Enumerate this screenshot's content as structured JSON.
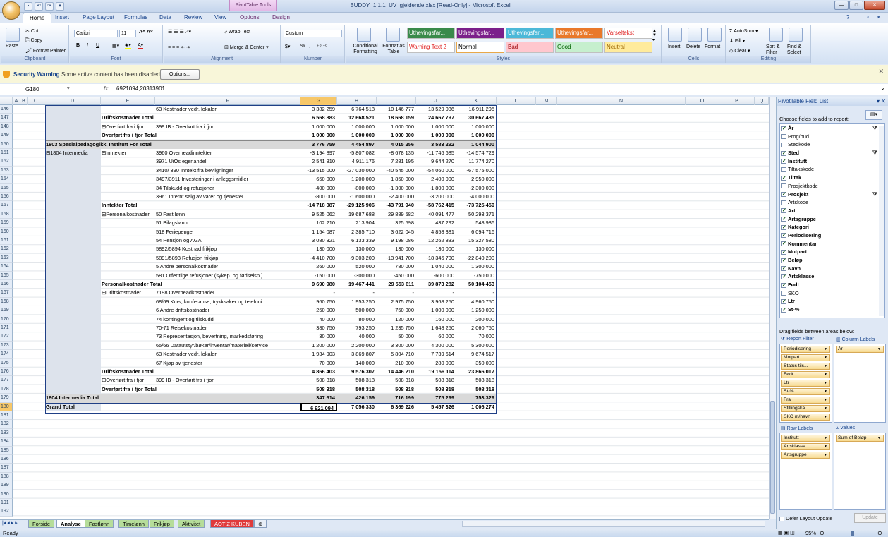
{
  "window": {
    "title": "BUDDY_1.1.1_UV_gjeldende.xlsx [Read-Only] - Microsoft Excel",
    "context_tab": "PivotTable Tools"
  },
  "tabs": [
    "Home",
    "Insert",
    "Page Layout",
    "Formulas",
    "Data",
    "Review",
    "View",
    "Options",
    "Design"
  ],
  "ribbon": {
    "clipboard": {
      "label": "Clipboard",
      "paste": "Paste",
      "cut": "Cut",
      "copy": "Copy",
      "format_painter": "Format Painter"
    },
    "font": {
      "label": "Font",
      "name": "Calibri",
      "size": "11",
      "bold": "B",
      "italic": "I",
      "underline": "U"
    },
    "alignment": {
      "label": "Alignment",
      "wrap": "Wrap Text",
      "merge": "Merge & Center"
    },
    "number": {
      "label": "Number",
      "format": "Custom",
      "pct": "%",
      "comma": ","
    },
    "styles": {
      "label": "Styles",
      "cond": "Conditional Formatting",
      "table": "Format as Table",
      "cells": [
        {
          "text": "Uthevingsfar...",
          "bg": "#3a8a4a",
          "fg": "#ffffff"
        },
        {
          "text": "Uthevingsfar...",
          "bg": "#7b1f8a",
          "fg": "#ffffff"
        },
        {
          "text": "Uthevingsfar...",
          "bg": "#4bb8d8",
          "fg": "#ffffff"
        },
        {
          "text": "Uthevingsfar...",
          "bg": "#e9782a",
          "fg": "#ffffff"
        },
        {
          "text": "Varseltekst",
          "bg": "#ffffff",
          "fg": "#e02020"
        },
        {
          "text": "Warning Text 2",
          "bg": "#ffffff",
          "fg": "#e02020"
        },
        {
          "text": "Normal",
          "bg": "#ffffff",
          "fg": "#000000"
        },
        {
          "text": "Bad",
          "bg": "#ffc7ce",
          "fg": "#9c0006"
        },
        {
          "text": "Good",
          "bg": "#c6efce",
          "fg": "#006100"
        },
        {
          "text": "Neutral",
          "bg": "#ffeb9c",
          "fg": "#9c6500"
        }
      ]
    },
    "cells": {
      "label": "Cells",
      "insert": "Insert",
      "delete": "Delete",
      "format": "Format"
    },
    "editing": {
      "label": "Editing",
      "autosum": "AutoSum",
      "fill": "Fill",
      "clear": "Clear",
      "sort": "Sort & Filter",
      "find": "Find & Select"
    }
  },
  "security": {
    "title": "Security Warning",
    "message": "Some active content has been disabled.",
    "button": "Options..."
  },
  "formula_bar": {
    "name_box": "G180",
    "fx": "fx",
    "value": "6921094,20313901"
  },
  "columns": [
    "A",
    "B",
    "C",
    "D",
    "E",
    "F",
    "G",
    "H",
    "I",
    "J",
    "K",
    "L",
    "M",
    "N",
    "O",
    "P",
    "Q"
  ],
  "rows": [
    {
      "n": "146",
      "d": "",
      "e": "",
      "f": "63 Kostnader vedr. lokaler",
      "v": [
        "3 382 259",
        "6 764 518",
        "10 146 777",
        "13 529 036",
        "16 911 295"
      ]
    },
    {
      "n": "147",
      "d": "",
      "e": "Driftskostnader Total",
      "f": "",
      "v": [
        "6 568 883",
        "12 668 521",
        "18 668 159",
        "24 667 797",
        "30 667 435"
      ],
      "bold": true
    },
    {
      "n": "148",
      "d": "",
      "e": "⊟Overført fra i fjor",
      "f": "399 IB - Overført fra i fjor",
      "v": [
        "1 000 000",
        "1 000 000",
        "1 000 000",
        "1 000 000",
        "1 000 000"
      ]
    },
    {
      "n": "149",
      "d": "",
      "e": "Overført fra i fjor Total",
      "f": "",
      "v": [
        "1 000 000",
        "1 000 000",
        "1 000 000",
        "1 000 000",
        "1 000 000"
      ],
      "bold": true
    },
    {
      "n": "150",
      "d": "1803 Spesialpedagogikk, Institutt For Total",
      "e": "",
      "f": "",
      "v": [
        "3 776 759",
        "4 454 897",
        "4 015 256",
        "3 583 292",
        "1 044 900"
      ],
      "bold": true,
      "shade": true
    },
    {
      "n": "151",
      "d": "⊟1804 Intermedia",
      "e": "⊟Inntekter",
      "f": "3960 Overheadinntekter",
      "v": [
        "-3 194 897",
        "-5 807 082",
        "-8 678 135",
        "-11 746 685",
        "-14 574 729"
      ]
    },
    {
      "n": "152",
      "d": "",
      "e": "",
      "f": "3971 UiOs egenandel",
      "v": [
        "2 541 810",
        "4 911 176",
        "7 281 195",
        "9 644 270",
        "11 774 270"
      ]
    },
    {
      "n": "153",
      "d": "",
      "e": "",
      "f": "3410/ 390 Inntekt fra bevilgninger",
      "v": [
        "-13 515 000",
        "-27 030 000",
        "-40 545 000",
        "-54 060 000",
        "-67 575 000"
      ]
    },
    {
      "n": "154",
      "d": "",
      "e": "",
      "f": "3497/3911 Investeringer i anleggsmidler",
      "v": [
        "650 000",
        "1 200 000",
        "1 850 000",
        "2 400 000",
        "2 950 000"
      ]
    },
    {
      "n": "155",
      "d": "",
      "e": "",
      "f": "34 Tilskudd og refusjoner",
      "v": [
        "-400 000",
        "-800 000",
        "-1 300 000",
        "-1 800 000",
        "-2 300 000"
      ]
    },
    {
      "n": "156",
      "d": "",
      "e": "",
      "f": "3961 Internt salg av varer og tjenester",
      "v": [
        "-800 000",
        "-1 600 000",
        "-2 400 000",
        "-3 200 000",
        "-4 000 000"
      ]
    },
    {
      "n": "157",
      "d": "",
      "e": "Inntekter Total",
      "f": "",
      "v": [
        "-14 718 087",
        "-29 125 906",
        "-43 791 940",
        "-58 762 415",
        "-73 725 459"
      ],
      "bold": true
    },
    {
      "n": "158",
      "d": "",
      "e": "⊟Personalkostnader",
      "f": "50 Fast lønn",
      "v": [
        "9 525 062",
        "19 687 688",
        "29 889 582",
        "40 091 477",
        "50 293 371"
      ]
    },
    {
      "n": "159",
      "d": "",
      "e": "",
      "f": "51 Bilagslønn",
      "v": [
        "102 210",
        "213 904",
        "325 598",
        "437 292",
        "548 986"
      ]
    },
    {
      "n": "160",
      "d": "",
      "e": "",
      "f": "518 Feriepenger",
      "v": [
        "1 154 087",
        "2 385 710",
        "3 622 045",
        "4 858 381",
        "6 094 716"
      ]
    },
    {
      "n": "161",
      "d": "",
      "e": "",
      "f": "54 Pensjon og AGA",
      "v": [
        "3 080 321",
        "6 133 339",
        "9 198 086",
        "12 262 833",
        "15 327 580"
      ]
    },
    {
      "n": "162",
      "d": "",
      "e": "",
      "f": "5892/5894 Kostnad frikjøp",
      "v": [
        "130 000",
        "130 000",
        "130 000",
        "130 000",
        "130 000"
      ]
    },
    {
      "n": "163",
      "d": "",
      "e": "",
      "f": "5891/5893 Refusjon frikjøp",
      "v": [
        "-4 410 700",
        "-9 303 200",
        "-13 941 700",
        "-18 346 700",
        "-22 840 200"
      ]
    },
    {
      "n": "164",
      "d": "",
      "e": "",
      "f": "5 Andre personalkostnader",
      "v": [
        "260 000",
        "520 000",
        "780 000",
        "1 040 000",
        "1 300 000"
      ]
    },
    {
      "n": "165",
      "d": "",
      "e": "",
      "f": "581 Offentlige refusjoner (sykep. og fødselsp.)",
      "v": [
        "-150 000",
        "-300 000",
        "-450 000",
        "-600 000",
        "-750 000"
      ]
    },
    {
      "n": "166",
      "d": "",
      "e": "Personalkostnader Total",
      "f": "",
      "v": [
        "9 690 980",
        "19 467 441",
        "29 553 611",
        "39 873 282",
        "50 104 453"
      ],
      "bold": true
    },
    {
      "n": "167",
      "d": "",
      "e": "⊟Driftskostnader",
      "f": "7198 Overheadkostnader",
      "v": [
        "-",
        "-",
        "-",
        "-",
        "-"
      ]
    },
    {
      "n": "168",
      "d": "",
      "e": "",
      "f": "68/69 Kurs, konferanse, trykksaker og telefoni",
      "v": [
        "960 750",
        "1 953 250",
        "2 975 750",
        "3 968 250",
        "4 960 750"
      ]
    },
    {
      "n": "169",
      "d": "",
      "e": "",
      "f": "6 Andre driftskostnader",
      "v": [
        "250 000",
        "500 000",
        "750 000",
        "1 000 000",
        "1 250 000"
      ]
    },
    {
      "n": "170",
      "d": "",
      "e": "",
      "f": "74 kontingent og tilskudd",
      "v": [
        "40 000",
        "80 000",
        "120 000",
        "160 000",
        "200 000"
      ]
    },
    {
      "n": "171",
      "d": "",
      "e": "",
      "f": "70-71 Reisekostnader",
      "v": [
        "380 750",
        "793 250",
        "1 235 750",
        "1 648 250",
        "2 060 750"
      ]
    },
    {
      "n": "172",
      "d": "",
      "e": "",
      "f": "73 Representasjon, bevertning, markedsføring",
      "v": [
        "30 000",
        "40 000",
        "50 000",
        "60 000",
        "70 000"
      ]
    },
    {
      "n": "173",
      "d": "",
      "e": "",
      "f": "65/66 Datautstyr/bøker/inventar/materiell/service",
      "v": [
        "1 200 000",
        "2 200 000",
        "3 300 000",
        "4 300 000",
        "5 300 000"
      ]
    },
    {
      "n": "174",
      "d": "",
      "e": "",
      "f": "63 Kostnader vedr. lokaler",
      "v": [
        "1 934 903",
        "3 869 807",
        "5 804 710",
        "7 739 614",
        "9 674 517"
      ]
    },
    {
      "n": "175",
      "d": "",
      "e": "",
      "f": "67 Kjøp av tjenester",
      "v": [
        "70 000",
        "140 000",
        "210 000",
        "280 000",
        "350 000"
      ]
    },
    {
      "n": "176",
      "d": "",
      "e": "Driftskostnader Total",
      "f": "",
      "v": [
        "4 866 403",
        "9 576 307",
        "14 446 210",
        "19 156 114",
        "23 866 017"
      ],
      "bold": true
    },
    {
      "n": "177",
      "d": "",
      "e": "⊟Overført fra i fjor",
      "f": "399 IB - Overført fra i fjor",
      "v": [
        "508 318",
        "508 318",
        "508 318",
        "508 318",
        "508 318"
      ]
    },
    {
      "n": "178",
      "d": "",
      "e": "Overført fra i fjor Total",
      "f": "",
      "v": [
        "508 318",
        "508 318",
        "508 318",
        "508 318",
        "508 318"
      ],
      "bold": true
    },
    {
      "n": "179",
      "d": "1804 Intermedia Total",
      "e": "",
      "f": "",
      "v": [
        "347 614",
        "426 159",
        "716 199",
        "775 299",
        "753 329"
      ],
      "bold": true,
      "shade": true
    },
    {
      "n": "180",
      "d": "Grand Total",
      "e": "",
      "f": "",
      "v": [
        "6 921 094",
        "7 056 330",
        "6 369 226",
        "5 457 326",
        "1 006 274"
      ],
      "bold": true,
      "grand": true
    }
  ],
  "empty_rows": [
    "181",
    "182",
    "183",
    "184",
    "185",
    "186",
    "187",
    "188",
    "189",
    "190",
    "191",
    "192"
  ],
  "sheet_tabs": [
    "Forside",
    "Analyse",
    "Fastlønn",
    "Timelønn",
    "Frikjøp",
    "Aktivitet",
    "AOT Z KUBEN"
  ],
  "status": {
    "left": "Ready",
    "zoom": "95%"
  },
  "pivot_pane": {
    "title": "PivotTable Field List",
    "choose": "Choose fields to add to report:",
    "fields": [
      {
        "name": "År",
        "checked": true,
        "filter": true
      },
      {
        "name": "Prog/bud",
        "checked": false
      },
      {
        "name": "Stedkode",
        "checked": false
      },
      {
        "name": "Sted",
        "checked": true,
        "filter": true
      },
      {
        "name": "Institutt",
        "checked": true
      },
      {
        "name": "Tiltakskode",
        "checked": false
      },
      {
        "name": "Tiltak",
        "checked": true
      },
      {
        "name": "Prosjektkode",
        "checked": false
      },
      {
        "name": "Prosjekt",
        "checked": true,
        "filter": true
      },
      {
        "name": "Artskode",
        "checked": false
      },
      {
        "name": "Art",
        "checked": true
      },
      {
        "name": "Artsgruppe",
        "checked": true
      },
      {
        "name": "Kategori",
        "checked": true
      },
      {
        "name": "Periodisering",
        "checked": true
      },
      {
        "name": "Kommentar",
        "checked": true
      },
      {
        "name": "Motpart",
        "checked": true
      },
      {
        "name": "Beløp",
        "checked": true
      },
      {
        "name": "Navn",
        "checked": true
      },
      {
        "name": "Artsklasse",
        "checked": true
      },
      {
        "name": "Født",
        "checked": true
      },
      {
        "name": "SKO",
        "checked": false
      },
      {
        "name": "Ltr",
        "checked": true
      },
      {
        "name": "St-%",
        "checked": true
      }
    ],
    "drag_label": "Drag fields between areas below:",
    "report_filter": "Report Filter",
    "column_labels": "Column Labels",
    "row_labels": "Row Labels",
    "values": "Values",
    "filters": [
      "Periodisering",
      "Motpart",
      "Status tils...",
      "Født",
      "Ltr",
      "St-%",
      "Fra",
      "Stillingska...",
      "SKO m/navn"
    ],
    "columns_area": [
      "År"
    ],
    "rows_area": [
      "Institutt",
      "Artsklasse",
      "Artsgruppe"
    ],
    "values_area": [
      "Sum of Beløp"
    ],
    "defer": "Defer Layout Update",
    "update": "Update"
  }
}
